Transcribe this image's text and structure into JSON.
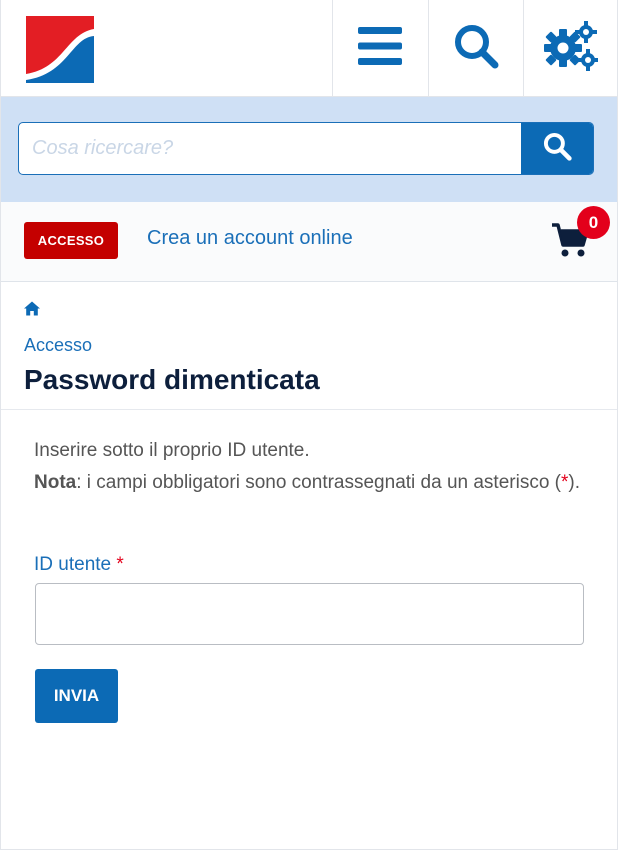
{
  "header": {
    "logo_icon": "brand-logo-icon",
    "menu_icon": "hamburger-menu-icon",
    "search_icon": "search-icon",
    "settings_icon": "gears-icon"
  },
  "search": {
    "placeholder": "Cosa ricercare?",
    "button_icon": "search-icon"
  },
  "account": {
    "login_label": "ACCESSO",
    "create_account_label": "Crea un account online",
    "cart_icon": "cart-icon",
    "cart_count": "0"
  },
  "breadcrumb": {
    "home_icon": "home-icon",
    "items": [
      "Accesso"
    ]
  },
  "page": {
    "title": "Password dimenticata"
  },
  "form": {
    "intro_line1": "Inserire sotto il proprio ID utente.",
    "note_label": "Nota",
    "note_text_before": ": i campi obbligatori sono contrassegnati da un asterisco (",
    "required_marker": "*",
    "note_text_after": ").",
    "userid_label": "ID utente",
    "userid_value": "",
    "submit_label": "INVIA"
  },
  "colors": {
    "primary": "#0c6ab5",
    "accent_red": "#c40000",
    "badge_red": "#e3001b",
    "search_band": "#cfe0f5",
    "title": "#0d1f3c"
  }
}
